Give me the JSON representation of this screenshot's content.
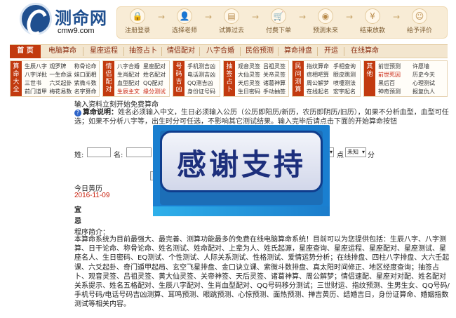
{
  "site": {
    "name": "测命网",
    "url": "cmw9.com"
  },
  "steps": [
    {
      "icon": "lock-icon",
      "glyph": "🔒",
      "label": "注册登录"
    },
    {
      "icon": "user-icon",
      "glyph": "👤",
      "label": "选择老师"
    },
    {
      "icon": "calc-icon",
      "glyph": "▤",
      "label": "试算过去"
    },
    {
      "icon": "cart-icon",
      "glyph": "🛒",
      "label": "付费下单"
    },
    {
      "icon": "eye-icon",
      "glyph": "◉",
      "label": "预测未来"
    },
    {
      "icon": "yen-icon",
      "glyph": "¥",
      "label": "结束放款"
    },
    {
      "icon": "thumb-icon",
      "glyph": "☺",
      "label": "给予评价"
    }
  ],
  "nav": [
    "首 页",
    "电脑算命",
    "星座运程",
    "抽签占卜",
    "情侣配对",
    "八字合婚",
    "民俗预测",
    "算命排盘",
    "开运",
    "在线算命"
  ],
  "categories": [
    {
      "title": "算命大全",
      "items": [
        "生辰八字",
        "观罗牌",
        "称骨论命",
        "八字详批",
        "一生命运",
        "妹口面相",
        "三世书",
        "六爻起卦",
        "紫微斗数",
        "前门道甲",
        "梅花易数",
        "名字算命"
      ],
      "hot": []
    },
    {
      "title": "情侣配对",
      "items": [
        "八字合婚",
        "星座配对",
        "生肖配对",
        "姓名配对",
        "血型配对",
        "QQ配对",
        "生辰主文",
        "缘分测试"
      ],
      "hot": [
        6,
        7
      ],
      "cols": 2
    },
    {
      "title": "号码吉凶",
      "items": [
        "手机测吉凶",
        "电话测吉凶",
        "QQ测吉凶",
        "身份证号码"
      ],
      "hot": [],
      "cols": 1
    },
    {
      "title": "抽签占卜",
      "items": [
        "观音灵签",
        "吕祖灵签",
        "大仙灵签",
        "关帝灵签",
        "天后灵签",
        "诸葛神算",
        "生日密码",
        "手动抽签"
      ],
      "hot": [],
      "cols": 2
    },
    {
      "title": "民间测算",
      "items": [
        "指纹算命",
        "手相查询",
        "痣相吧算",
        "眼皮跳测",
        "周公解梦",
        "喷嚏测法",
        "在线起名",
        "宏宇起名"
      ],
      "hot": [],
      "cols": 2
    },
    {
      "title": "其他",
      "items": [
        "前世预测",
        "许愿墙",
        "前世死因",
        "历史今天",
        "黑后百",
        "心理测试",
        "神奇预测",
        "报复仇人"
      ],
      "hot": [
        2
      ],
      "cols": 2
    }
  ],
  "main": {
    "heading": "输入资料立刻开始免费算命",
    "intro_label": "算命说明：",
    "intro_text": "姓名必须输入中文，生日必须输入公历（公历即阳历/新历，农历即阴历/旧历），如果不分析血型，血型可任选；如果不分析八字等，出生时分可任选，不影响其它测试结果。输入完毕后请点击下面的开始算命按钮",
    "form": {
      "surname_label": "姓:",
      "name_label": "名:",
      "dot_label": "点",
      "hour_value": "未知",
      "minute_label": "分"
    },
    "date_title": "今日黄历",
    "date_value": "2016-11-09",
    "yi": "宜",
    "ji": "忌",
    "program_title": "程序简介：",
    "program_text": "本算命系统为目前最强大、最完善、测算功能最多的免费在线电脑算命系统！目前可以为您提供包括：生辰八字、八字测算、日干论命、称骨论命、姓名测试、姓命配对、上辈为人、姓氏起源，星座查询、星座运程、星座配对、星座测试、星座名人、生日密码、EQ测试、个性测试、人际关系测试、性格测试、爱情运势分析；在线排盘、四柱八字排盘、大六壬起课、六爻起卦、奇门遁甲起局、玄空飞星排盘、金口诀立课、紫微斗数排盘、真太阳时间修正、地区经度查询；抽签占卜、观音灵签、吕祖灵签、黄大仙灵签、关帝神签、天后灵签、诸葛神算、周公解梦；情侣速配、星座对对配、姓名配对关系提示、姓名五格配对、生辰八字配对、生肖血型配对、QQ号码移分测试；三世财运、指纹预测、生男生女、QQ号码/手机号码/电话号码吉凶测算、耳鸣预测、眼跳预测、心惊预测、面热预测、掸吉黄历、结婚吉日，身份证算命、婚姻指数测试等相关内容。"
  },
  "overlay": {
    "text": "感谢支持"
  }
}
